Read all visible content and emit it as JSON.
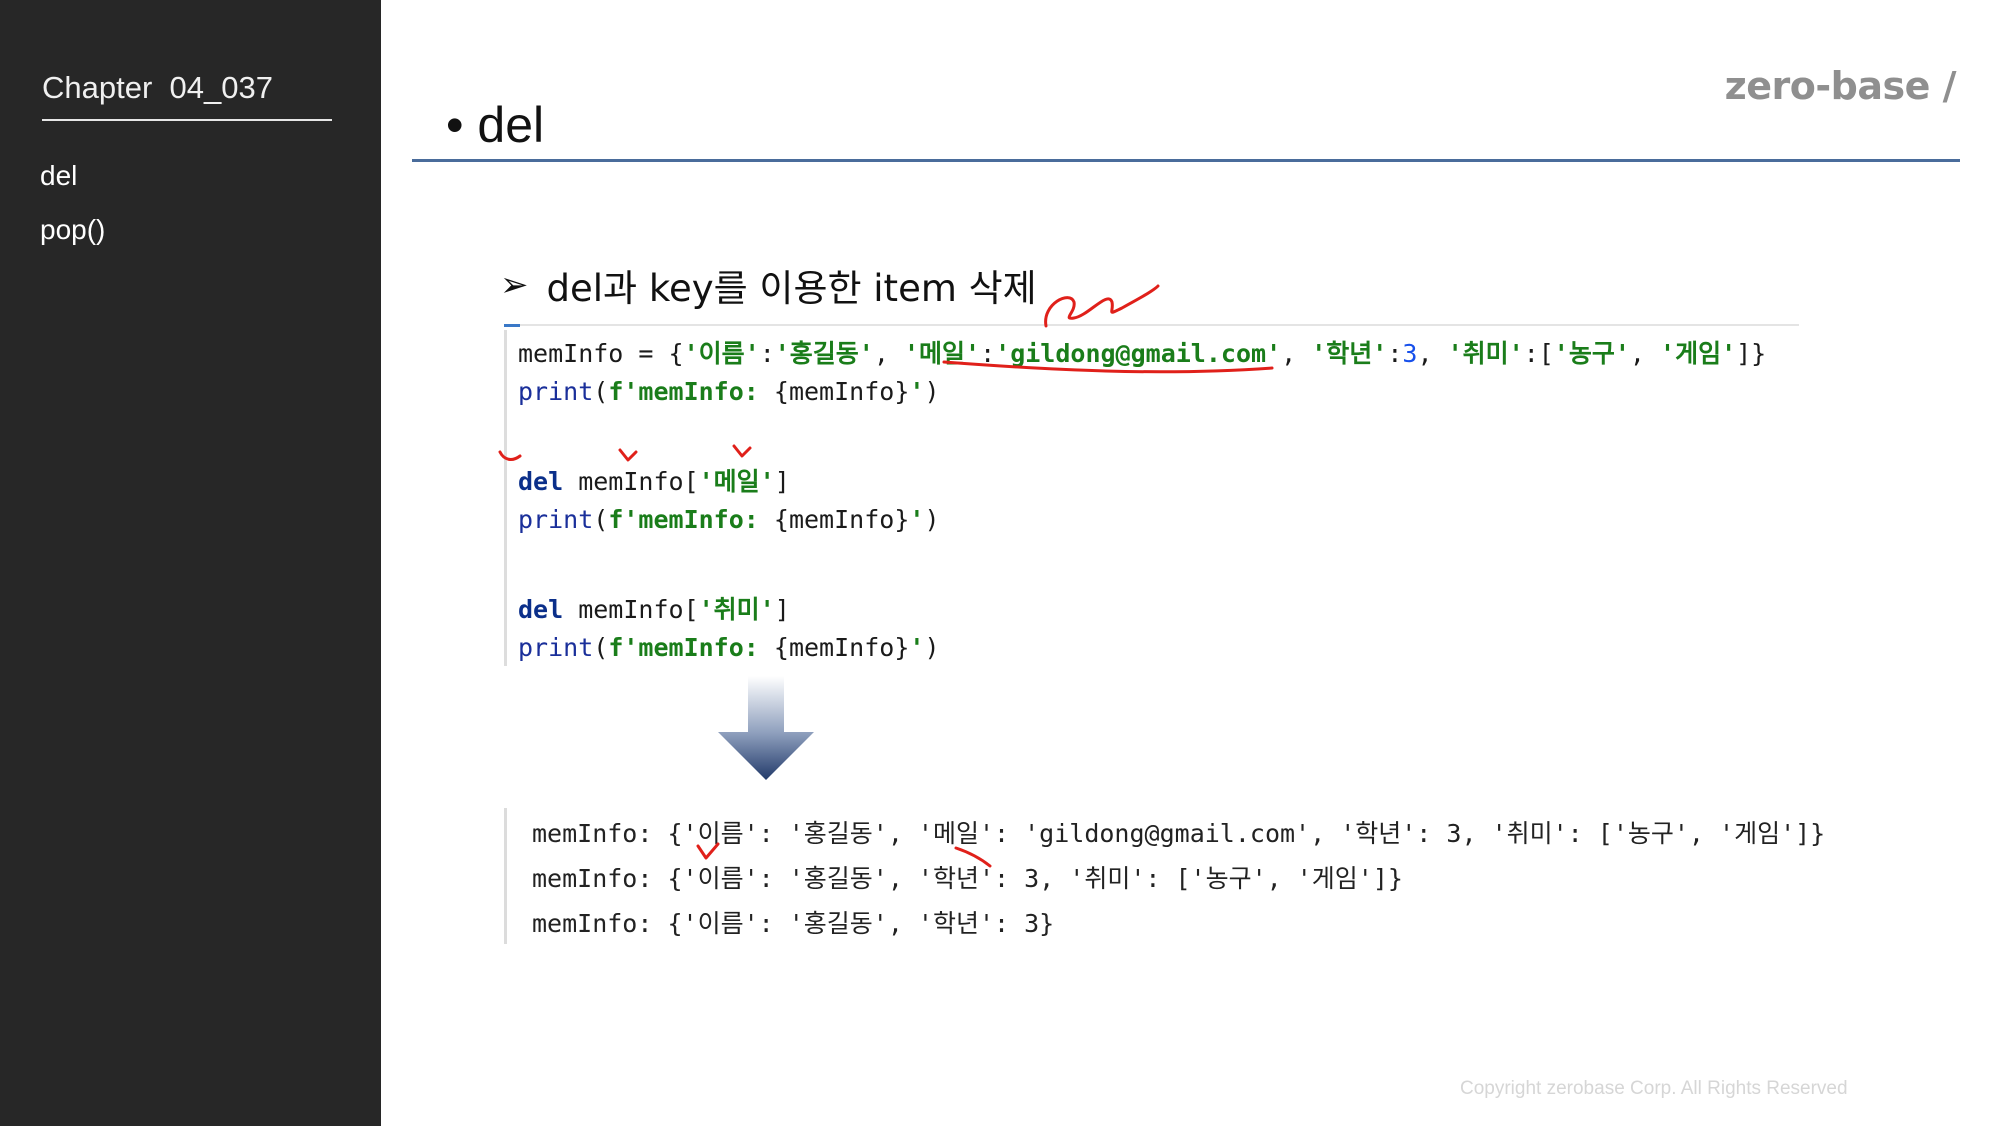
{
  "sidebar": {
    "chapter": "Chapter  04_037",
    "items": [
      {
        "label": "del"
      },
      {
        "label": "pop()"
      }
    ]
  },
  "header": {
    "logo": "zero-base /",
    "title": "• del"
  },
  "section": {
    "bullet": "➢",
    "title": "del과 key를 이용한 item 삭제"
  },
  "code": {
    "line1": {
      "p1": "memInfo = {",
      "s1": "'이름'",
      "p2": ":",
      "s2": "'홍길동'",
      "p3": ", ",
      "s3": "'메일'",
      "p4": ":",
      "s4": "'gildong@gmail.com'",
      "p5": ", ",
      "s5": "'학년'",
      "p6": ":",
      "n1": "3",
      "p7": ", ",
      "s6": "'취미'",
      "p8": ":[",
      "s7": "'농구'",
      "p9": ", ",
      "s8": "'게임'",
      "p10": "]}"
    },
    "print_fn": "print",
    "print_open": "(",
    "print_str_a": "f'memInfo: ",
    "print_expr": "{memInfo}",
    "print_str_b": "'",
    "print_close": ")",
    "del_kw": "del",
    "del1_target": " memInfo[",
    "del1_key": "'메일'",
    "del2_key": "'취미'",
    "del_close": "]"
  },
  "output": {
    "line1": "memInfo: {'이름': '홍길동', '메일': 'gildong@gmail.com', '학년': 3, '취미': ['농구', '게임']}",
    "line2": "memInfo: {'이름': '홍길동', '학년': 3, '취미': ['농구', '게임']}",
    "line3": "memInfo: {'이름': '홍길동', '학년': 3}"
  },
  "footer": {
    "copyright": "Copyright zerobase Corp. All Rights Reserved"
  },
  "colors": {
    "sidebar_bg": "#272727",
    "title_rule": "#4a6c9b",
    "keyword": "#0b2f8a",
    "string": "#1a7d1a",
    "number": "#1750eb",
    "annotation": "#e0201a"
  }
}
